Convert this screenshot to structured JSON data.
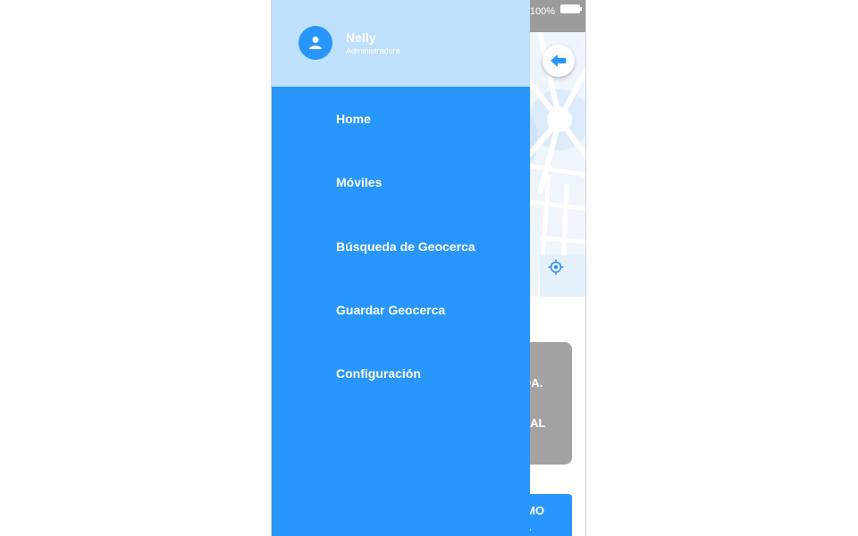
{
  "status_bar": {
    "battery_text": "100%"
  },
  "drawer": {
    "user": {
      "name": "Nelly",
      "role": "Administradora"
    },
    "menu_items": [
      {
        "label": "Home"
      },
      {
        "label": "Móviles"
      },
      {
        "label": "Búsqueda de Geocerca"
      },
      {
        "label": "Guardar Geocerca"
      },
      {
        "label": "Configuración"
      }
    ]
  },
  "background": {
    "card_line1": "LTDA.",
    "card_line2": "ORIAL",
    "button_line1": "OMO",
    "button_line2": "TA"
  },
  "icons": {
    "avatar": "person-icon",
    "back": "arrow-left-icon",
    "locate": "crosshair-icon",
    "battery": "battery-icon"
  },
  "colors": {
    "drawer_bg": "#2896fc",
    "drawer_header_bg": "#bfe0fd",
    "status_bar": "#9c9c9c",
    "card_gray": "#a3a3a3"
  }
}
